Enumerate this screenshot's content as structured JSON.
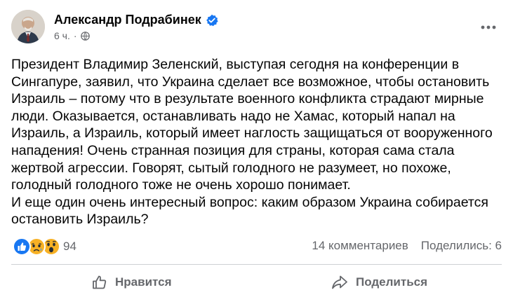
{
  "post": {
    "author": "Александр Подрабинек",
    "time": "6 ч.",
    "separator": "·",
    "text": "Президент Владимир Зеленский, выступая сегодня на конференции в Сингапуре, заявил, что Украина сделает все возможное, чтобы остановить Израиль – потому что в результате военного конфликта страдают мирные люди. Оказывается, останавливать надо не Хамас, который напал на Израиль, а Израиль, который имеет наглость защищаться от вооруженного нападения! Очень странная позиция для страны, которая сама стала жертвой агрессии. Говорят, сытый голодного не разумеет, но похоже, голодный голодного тоже не очень хорошо понимает.\nИ еще один очень интересный вопрос: каким образом Украина собирается остановить Израиль?"
  },
  "reactions": {
    "icons": [
      "like-reaction-icon",
      "sad-reaction-icon",
      "wow-reaction-icon"
    ],
    "count": "94",
    "comments": "14 комментариев",
    "shares": "Поделились: 6"
  },
  "actions": {
    "like_label": "Нравится",
    "share_label": "Поделиться"
  },
  "colors": {
    "text": "#050505",
    "secondary": "#65676b",
    "verified": "#1877f2",
    "like_blue": "#1877f2",
    "sad_yellow": "#f7b125",
    "divider": "#ced0d4"
  }
}
